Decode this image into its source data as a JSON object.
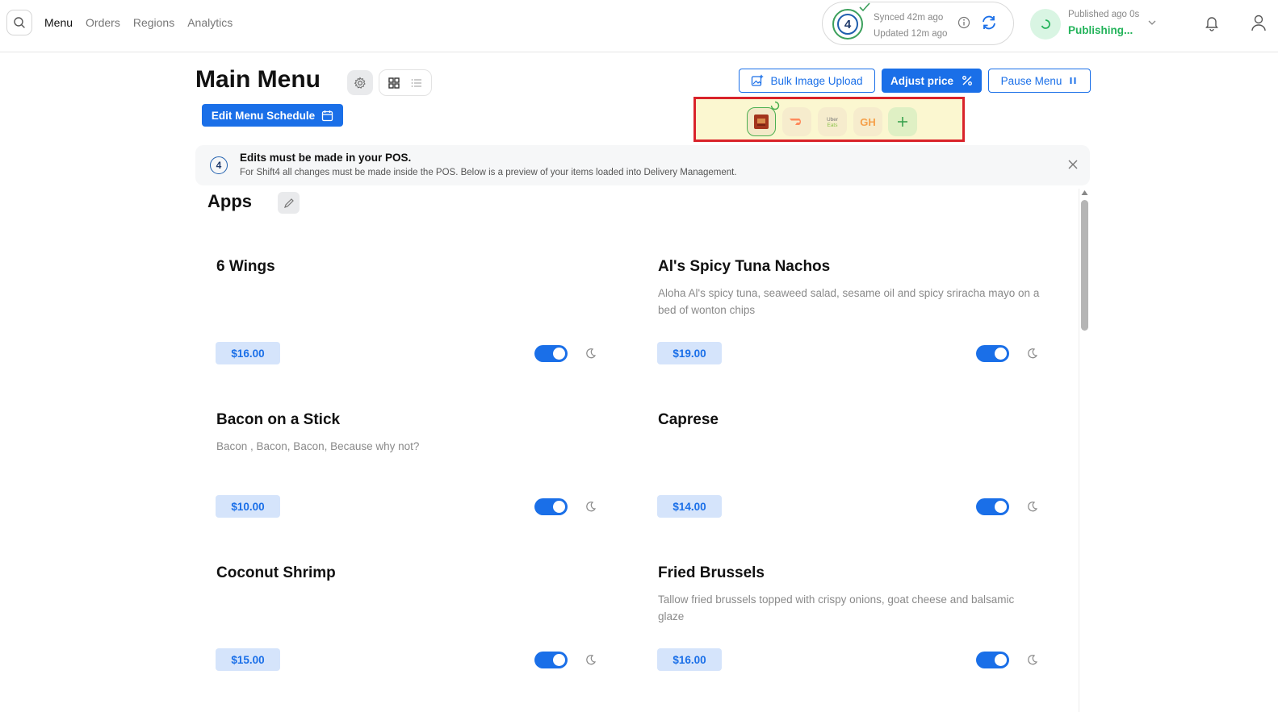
{
  "nav": {
    "items": [
      {
        "label": "Menu",
        "active": true
      },
      {
        "label": "Orders",
        "active": false
      },
      {
        "label": "Regions",
        "active": false
      },
      {
        "label": "Analytics",
        "active": false
      }
    ]
  },
  "sync": {
    "synced": "Synced 42m ago",
    "updated": "Updated 12m ago",
    "logo_text": "4"
  },
  "publish": {
    "label": "Published ago 0s",
    "status": "Publishing..."
  },
  "header": {
    "title": "Main Menu",
    "edit_schedule": "Edit Menu Schedule",
    "bulk_upload": "Bulk Image Upload",
    "adjust_price": "Adjust price",
    "pause_menu": "Pause Menu"
  },
  "platforms": [
    {
      "icon": "shift4-store-icon",
      "color": "#a3341c"
    },
    {
      "icon": "doordash-icon",
      "color": "#ff3008"
    },
    {
      "icon": "uber-eats-icon",
      "text": "Uber Eats",
      "color": "#06c167"
    },
    {
      "icon": "grubhub-icon",
      "text": "GH",
      "color": "#f63440"
    },
    {
      "icon": "add-platform-icon",
      "color": "#3aa24f"
    }
  ],
  "notice": {
    "title": "Edits must be made in your POS.",
    "body": "For Shift4 all changes must be made inside the POS. Below is a preview of your items loaded into Delivery Management.",
    "icon_text": "4"
  },
  "category": {
    "name": "Apps"
  },
  "items": [
    {
      "name": "6 Wings",
      "description": "",
      "price": "$16.00",
      "enabled": true
    },
    {
      "name": "Al's Spicy Tuna Nachos",
      "description": "Aloha Al's spicy tuna, seaweed salad, sesame oil and spicy sriracha mayo on a bed of wonton chips",
      "price": "$19.00",
      "enabled": true
    },
    {
      "name": "Bacon on a Stick",
      "description": "Bacon , Bacon, Bacon, Because why not?",
      "price": "$10.00",
      "enabled": true
    },
    {
      "name": "Caprese",
      "description": "",
      "price": "$14.00",
      "enabled": true
    },
    {
      "name": "Coconut Shrimp",
      "description": "",
      "price": "$15.00",
      "enabled": true
    },
    {
      "name": "Fried Brussels",
      "description": "Tallow fried brussels topped with crispy onions, goat cheese and balsamic glaze",
      "price": "$16.00",
      "enabled": true
    }
  ],
  "colors": {
    "accent": "#1a6fe8",
    "publishing": "#23b35a",
    "highlight_border": "#d9232a",
    "highlight_fill": "#fbf7d0"
  }
}
